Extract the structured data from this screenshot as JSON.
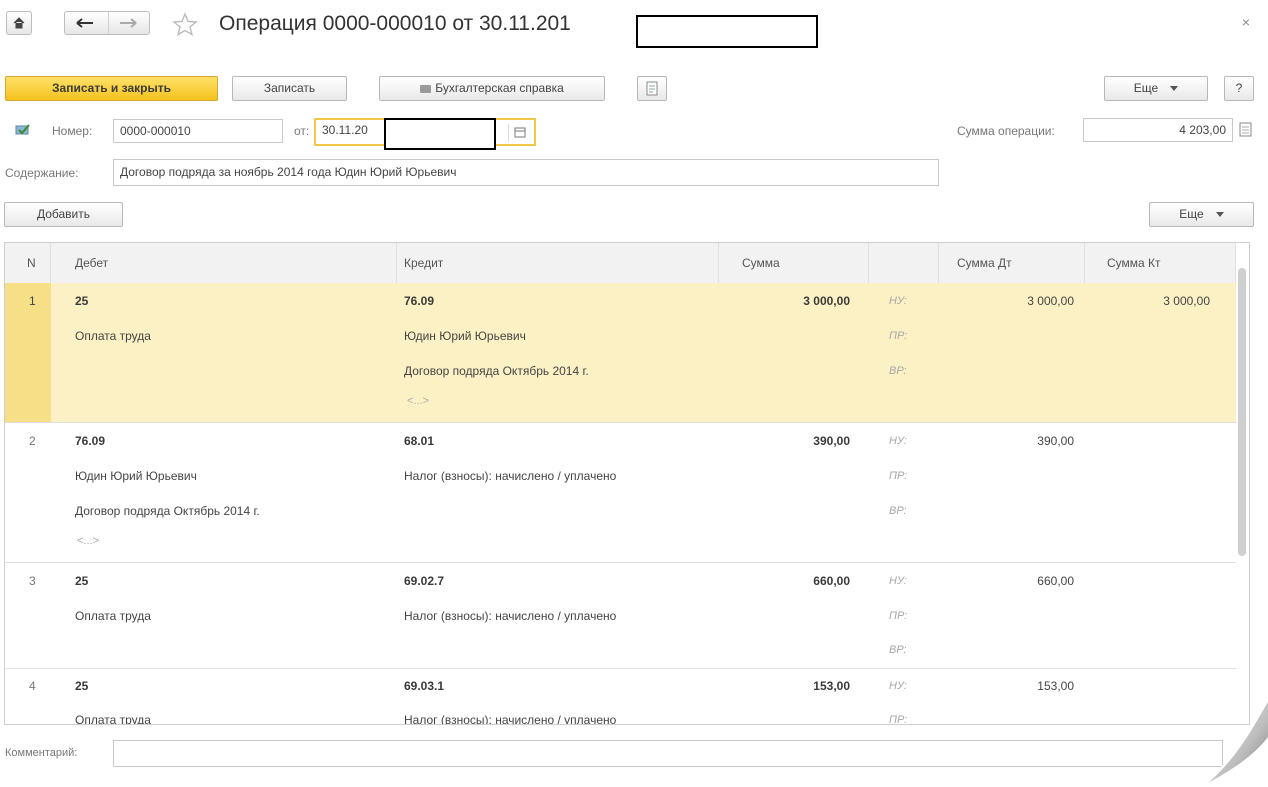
{
  "window": {
    "title": "Операция 0000-000010 от 30.11.201",
    "close": "×"
  },
  "toolbar": {
    "save_close": "Записать и закрыть",
    "save": "Записать",
    "report": "Бухгалтерская справка",
    "more": "Еще",
    "help": "?"
  },
  "form": {
    "number_label": "Номер:",
    "number_value": "0000-000010",
    "date_label": "от:",
    "date_value": "30.11.20",
    "sum_label": "Сумма операции:",
    "sum_value": "4 203,00",
    "content_label": "Содержание:",
    "content_value": "Договор подряда за ноябрь 2014 года Юдин Юрий Юрьевич",
    "comment_label": "Комментарий:"
  },
  "table_toolbar": {
    "add": "Добавить",
    "more": "Еще"
  },
  "columns": [
    "N",
    "Дебет",
    "Кредит",
    "Сумма",
    "",
    "Сумма Дт",
    "Сумма Кт"
  ],
  "reg_labels": [
    "НУ:",
    "ПР:",
    "ВР:"
  ],
  "rows": [
    {
      "n": "1",
      "debit": [
        "25",
        "Оплата труда",
        ""
      ],
      "credit": [
        "76.09",
        "Юдин Юрий Юрьевич",
        "Договор подряда Октябрь 2014 г."
      ],
      "dots": "<...>",
      "sum": "3 000,00",
      "sum_dt": "3 000,00",
      "sum_kt": "3 000,00",
      "selected": true
    },
    {
      "n": "2",
      "debit": [
        "76.09",
        "Юдин Юрий Юрьевич",
        "Договор подряда Октябрь 2014 г."
      ],
      "credit": [
        "68.01",
        "Налог (взносы): начислено / уплачено",
        ""
      ],
      "dots": "<...>",
      "sum": "390,00",
      "sum_dt": "390,00",
      "sum_kt": ""
    },
    {
      "n": "3",
      "debit": [
        "25",
        "Оплата труда",
        ""
      ],
      "credit": [
        "69.02.7",
        "Налог (взносы): начислено / уплачено",
        ""
      ],
      "sum": "660,00",
      "sum_dt": "660,00",
      "sum_kt": ""
    },
    {
      "n": "4",
      "debit": [
        "25",
        "Оплата труда",
        ""
      ],
      "credit": [
        "69.03.1",
        "Налог (взносы): начислено / уплачено",
        ""
      ],
      "sum": "153,00",
      "sum_dt": "153,00",
      "sum_kt": ""
    }
  ]
}
